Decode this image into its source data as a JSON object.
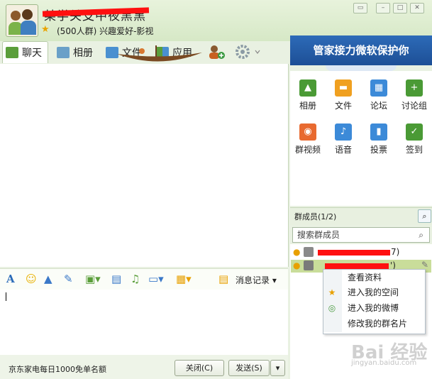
{
  "header": {
    "group_name": "某学关支中夜黑黑",
    "group_desc": "(500人群) 兴趣爱好-影视"
  },
  "tabs": [
    {
      "label": "聊天"
    },
    {
      "label": "相册"
    },
    {
      "label": "文件"
    },
    {
      "label": "应用"
    }
  ],
  "banner": {
    "text": "管家接力微软保护你"
  },
  "apps": [
    {
      "label": "相册",
      "icon": "photo-icon",
      "color": "#4a9a35"
    },
    {
      "label": "文件",
      "icon": "folder-icon",
      "color": "#f0a020"
    },
    {
      "label": "论坛",
      "icon": "forum-icon",
      "color": "#3c8ad8"
    },
    {
      "label": "讨论组",
      "icon": "discussion-icon",
      "color": "#4a9a35"
    },
    {
      "label": "群视频",
      "icon": "video-icon",
      "color": "#e86a30"
    },
    {
      "label": "语音",
      "icon": "voice-icon",
      "color": "#3c8ad8"
    },
    {
      "label": "投票",
      "icon": "vote-icon",
      "color": "#3c8ad8"
    },
    {
      "label": "签到",
      "icon": "checkin-icon",
      "color": "#4a9a35"
    }
  ],
  "format_bar": {
    "history_label": "消息记录"
  },
  "bottom": {
    "promo": "京东家电每日1000免单名额",
    "close_label": "关闭(C)",
    "send_label": "发送(S)"
  },
  "members": {
    "title": "群成员(1/2)",
    "search_placeholder": "搜索群成员",
    "rows": [
      {
        "suffix": "7)"
      },
      {
        "suffix": "')"
      }
    ]
  },
  "context_menu": {
    "items": [
      {
        "label": "查看资料",
        "icon": ""
      },
      {
        "label": "进入我的空间",
        "icon": "star-icon"
      },
      {
        "label": "进入我的微博",
        "icon": "weibo-icon"
      },
      {
        "label": "修改我的群名片",
        "icon": ""
      }
    ]
  },
  "watermark": {
    "text": "Bai 经验",
    "sub": "jingyan.baidu.com"
  }
}
